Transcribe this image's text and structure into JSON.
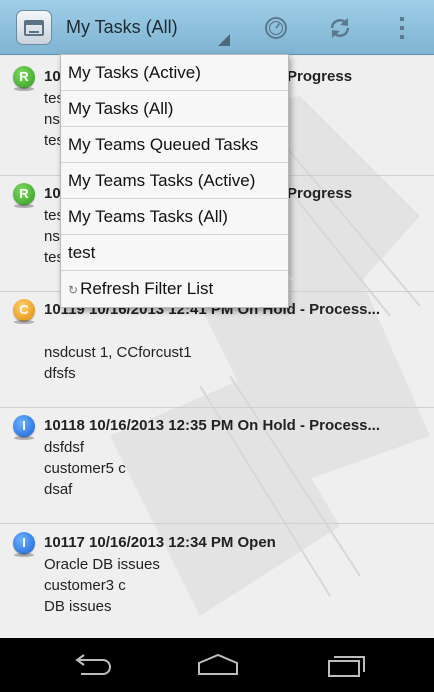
{
  "actionbar": {
    "title": "My Tasks (All)",
    "icons": [
      "inbox-tray-icon",
      "clock-icon",
      "sync-icon",
      "overflow-menu-icon"
    ]
  },
  "dropdown": {
    "items": [
      {
        "label": "My Tasks (Active)"
      },
      {
        "label": "My Tasks (All)"
      },
      {
        "label": "My Teams Queued Tasks"
      },
      {
        "label": "My Teams Tasks (Active)"
      },
      {
        "label": "My Teams Tasks (All)"
      },
      {
        "label": "test"
      },
      {
        "label": "Refresh Filter List",
        "icon": "refresh-icon",
        "glyph": "↻"
      }
    ]
  },
  "tasks": [
    {
      "badge": "R",
      "badge_color": "#2f9a1f",
      "head_left": "10",
      "head_right": "Progress",
      "lines": [
        "tes",
        "ns",
        "tes"
      ]
    },
    {
      "badge": "R",
      "badge_color": "#2f9a1f",
      "head_left": "10",
      "head_right": "Progress",
      "lines": [
        "tes",
        "ns",
        "tes"
      ]
    },
    {
      "badge": "C",
      "badge_color": "#e08a00",
      "head": "10119   10/16/2013 12:41 PM   On Hold - Process...",
      "lines": [
        "",
        "nsdcust 1, CCforcust1",
        "dfsfs"
      ]
    },
    {
      "badge": "I",
      "badge_color": "#1560d8",
      "head": "10118   10/16/2013 12:35 PM   On Hold - Process...",
      "lines": [
        "dsfdsf",
        "customer5 c",
        "dsaf"
      ]
    },
    {
      "badge": "I",
      "badge_color": "#1560d8",
      "head": "10117   10/16/2013 12:34 PM   Open",
      "lines": [
        "Oracle DB issues",
        "customer3 c",
        "DB issues"
      ]
    }
  ],
  "navbar": {
    "buttons": [
      "back-icon",
      "home-icon",
      "recent-apps-icon"
    ]
  }
}
